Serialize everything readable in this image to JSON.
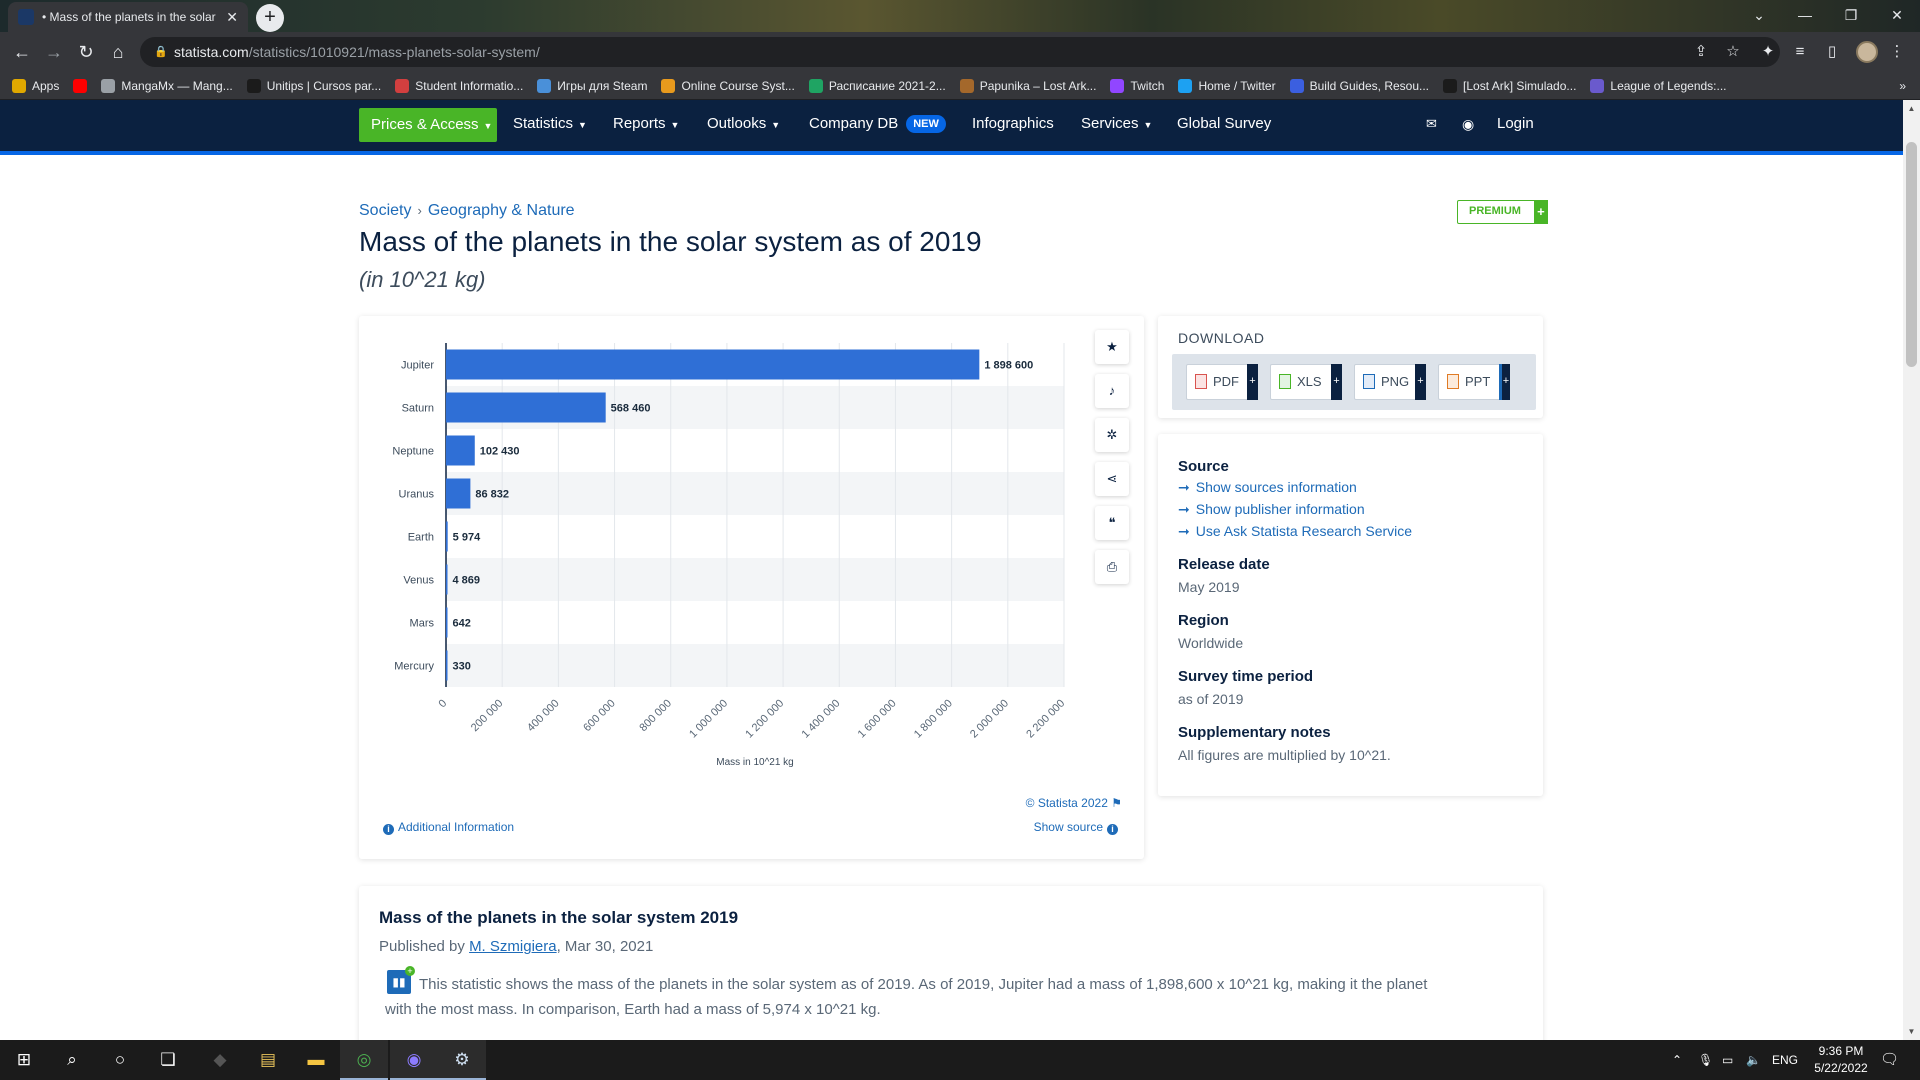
{
  "browser": {
    "tab_title": "• Mass of the planets in the solar",
    "tab_close": "✕",
    "new_tab": "+",
    "url_domain": "statista.com",
    "url_path": "/statistics/1010921/mass-planets-solar-system/",
    "bookmarks": [
      {
        "label": "Apps",
        "color": "#e0a800"
      },
      {
        "label": "",
        "color": "#ff0000"
      },
      {
        "label": "MangaMx — Mang...",
        "color": "#9aa0a6"
      },
      {
        "label": "Unitips | Cursos par...",
        "color": "#1b1b1b"
      },
      {
        "label": "Student Informatio...",
        "color": "#d23f3f"
      },
      {
        "label": "Игры для Steam",
        "color": "#4a90d9"
      },
      {
        "label": "Online Course Syst...",
        "color": "#e89a1d"
      },
      {
        "label": "Расписание 2021-2...",
        "color": "#1fa463"
      },
      {
        "label": "Papunika – Lost Ark...",
        "color": "#a4682b"
      },
      {
        "label": "Twitch",
        "color": "#9146ff"
      },
      {
        "label": "Home / Twitter",
        "color": "#1da1f2"
      },
      {
        "label": "Build Guides, Resou...",
        "color": "#3b5fe0"
      },
      {
        "label": "[Lost Ark] Simulado...",
        "color": "#1b1b1b"
      },
      {
        "label": "League of Legends:...",
        "color": "#6a5acd"
      }
    ]
  },
  "nav": {
    "prices": "Prices & Access",
    "statistics": "Statistics",
    "reports": "Reports",
    "outlooks": "Outlooks",
    "company_db": "Company DB",
    "new_badge": "NEW",
    "infographics": "Infographics",
    "services": "Services",
    "global_survey": "Global Survey",
    "login": "Login"
  },
  "page": {
    "breadcrumb_1": "Society",
    "breadcrumb_2": "Geography & Nature",
    "premium": "PREMIUM",
    "title": "Mass of the planets in the solar system as of 2019",
    "subtitle": "(in 10^21 kg)"
  },
  "chart_data": {
    "type": "bar",
    "orientation": "horizontal",
    "categories": [
      "Jupiter",
      "Saturn",
      "Neptune",
      "Uranus",
      "Earth",
      "Venus",
      "Mars",
      "Mercury"
    ],
    "values": [
      1898600,
      568460,
      102430,
      86832,
      5974,
      4869,
      642,
      330
    ],
    "value_labels": [
      "1 898 600",
      "568 460",
      "102 430",
      "86 832",
      "5 974",
      "4 869",
      "642",
      "330"
    ],
    "x_ticks": [
      "0",
      "200 000",
      "400 000",
      "600 000",
      "800 000",
      "1 000 000",
      "1 200 000",
      "1 400 000",
      "1 600 000",
      "1 800 000",
      "2 000 000",
      "2 200 000"
    ],
    "xlim": [
      0,
      2200000
    ],
    "xlabel": "Mass in 10^21 kg",
    "bar_color": "#2f6fd6",
    "grid": true
  },
  "chart_footer": {
    "copyright": "© Statista 2022",
    "show_source": "Show source",
    "additional_info": "Additional Information"
  },
  "download": {
    "title": "DOWNLOAD",
    "formats": [
      "PDF",
      "XLS",
      "PNG",
      "PPT"
    ]
  },
  "meta": {
    "source_h": "Source",
    "link_1": "Show sources information",
    "link_2": "Show publisher information",
    "link_3": "Use Ask Statista Research Service",
    "release_h": "Release date",
    "release_v": "May 2019",
    "region_h": "Region",
    "region_v": "Worldwide",
    "survey_h": "Survey time period",
    "survey_v": "as of 2019",
    "notes_h": "Supplementary notes",
    "notes_v": "All figures are multiplied by 10^21."
  },
  "description": {
    "title": "Mass of the planets in the solar system 2019",
    "published_prefix": "Published by ",
    "author": "M. Szmigiera",
    "date": ", Mar 30, 2021",
    "text": "This statistic shows the mass of the planets in the solar system as of 2019. As of 2019, Jupiter had a mass of 1,898,600 x 10^21 kg, making it the planet with the most mass. In comparison, Earth had a mass of 5,974 x 10^21 kg."
  },
  "taskbar": {
    "lang": "ENG",
    "time": "9:36 PM",
    "date": "5/22/2022"
  }
}
